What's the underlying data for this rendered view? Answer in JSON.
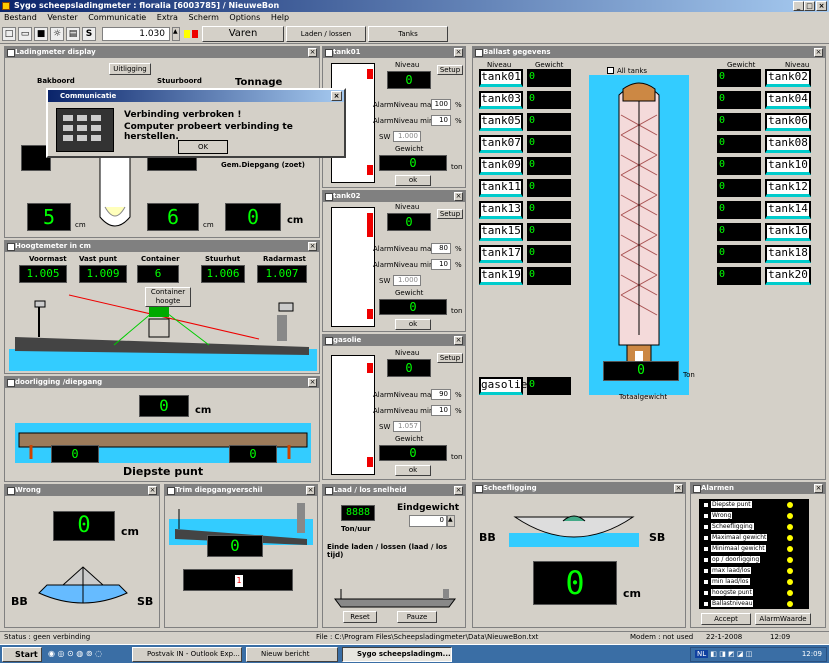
{
  "window": {
    "title": "Sygo scheepsladingmeter : floralia [6003785] / NieuweBon"
  },
  "menu": [
    "Bestand",
    "Venster",
    "Communicatie",
    "Extra",
    "Scherm",
    "Options",
    "Help"
  ],
  "toolbar": {
    "value": "1.030",
    "varen": "Varen",
    "laden": "Laden / lossen",
    "tanks": "Tanks"
  },
  "ladingmeter": {
    "title": "Ladingmeter display",
    "uitlogging": "Uitligging",
    "bakboord": "Bakboord",
    "stuurboord": "Stuurboord",
    "tonnage": "Tonnage",
    "gem_label": "Gem.Diepgang (zoet)",
    "v1": "5",
    "v2": "6",
    "v3": "0",
    "cm": "cm"
  },
  "dialog": {
    "title": "Communicatie",
    "line1": "Verbinding verbroken !",
    "line2": "Computer probeert verbinding te herstellen.",
    "ok": "OK"
  },
  "hoogtemeter": {
    "title": "Hoogtemeter in cm",
    "cols": [
      "Voormast",
      "Vast punt",
      "Container",
      "Stuurhut",
      "Radarmast"
    ],
    "vals": [
      "1.005",
      "1.009",
      "6",
      "1.006",
      "1.007"
    ],
    "container_hoogte": "Container hoogte"
  },
  "doorligging": {
    "title": "doorligging /diepgang",
    "v": "0",
    "cm": "cm",
    "left": "0",
    "right": "0",
    "diepste": "Diepste punt"
  },
  "tank01": {
    "title": "tank01",
    "niveau": "Niveau",
    "niveau_v": "0",
    "alarm_max": "AlarmNiveau max",
    "max_v": "100",
    "alarm_min": "AlarmNiveau min",
    "min_v": "10",
    "sw": "SW",
    "sw_v": "1.000",
    "gewicht": "Gewicht",
    "gew_v": "0",
    "ton": "ton",
    "ok": "ok",
    "setup": "Setup",
    "pct": "%"
  },
  "tank02": {
    "title": "tank02",
    "niveau": "Niveau",
    "niveau_v": "0",
    "alarm_max": "AlarmNiveau max",
    "max_v": "80",
    "alarm_min": "AlarmNiveau min",
    "min_v": "10",
    "sw": "SW",
    "sw_v": "1.000",
    "gewicht": "Gewicht",
    "gew_v": "0",
    "ton": "ton",
    "ok": "ok",
    "setup": "Setup",
    "pct": "%"
  },
  "gasolie": {
    "title": "gasolie",
    "niveau": "Niveau",
    "niveau_v": "0",
    "alarm_max": "AlarmNiveau max",
    "max_v": "90",
    "alarm_min": "AlarmNiveau min",
    "min_v": "10",
    "sw": "SW",
    "sw_v": "1.057",
    "gewicht": "Gewicht",
    "gew_v": "0",
    "ton": "ton",
    "ok": "ok",
    "setup": "Setup",
    "pct": "%"
  },
  "ballast": {
    "title": "Ballast gegevens",
    "niveau": "Niveau",
    "gewicht": "Gewicht",
    "all_tanks": "All tanks",
    "left": [
      [
        "tank01",
        "0"
      ],
      [
        "tank03",
        "0"
      ],
      [
        "tank05",
        "0"
      ],
      [
        "tank07",
        "0"
      ],
      [
        "tank09",
        "0"
      ],
      [
        "tank11",
        "0"
      ],
      [
        "tank13",
        "0"
      ],
      [
        "tank15",
        "0"
      ],
      [
        "tank17",
        "0"
      ],
      [
        "tank19",
        "0"
      ]
    ],
    "right": [
      [
        "tank02",
        "0"
      ],
      [
        "tank04",
        "0"
      ],
      [
        "tank06",
        "0"
      ],
      [
        "tank08",
        "0"
      ],
      [
        "tank10",
        "0"
      ],
      [
        "tank12",
        "0"
      ],
      [
        "tank14",
        "0"
      ],
      [
        "tank16",
        "0"
      ],
      [
        "tank18",
        "0"
      ],
      [
        "tank20",
        "0"
      ]
    ],
    "gasolie": "gasolie",
    "gasolie_v": "0",
    "total_v": "0",
    "ton": "Ton",
    "totaalgewicht": "Totaalgewicht"
  },
  "wrong": {
    "title": "Wrong",
    "v": "0",
    "cm": "cm",
    "bb": "BB",
    "sb": "SB"
  },
  "trim": {
    "title": "Trim diepgangverschil",
    "v": "0",
    "small": "1"
  },
  "laad": {
    "title": "Laad / los snelheid",
    "lcd": "8888",
    "tonuur": "Ton/uur",
    "eind": "Eindgewicht",
    "eind_v": "0",
    "einde": "Einde laden / lossen (laad / los tijd)",
    "reset": "Reset",
    "pauze": "Pauze"
  },
  "scheef": {
    "title": "Scheefligging",
    "v": "0",
    "cm": "cm",
    "bb": "BB",
    "sb": "SB"
  },
  "alarmen": {
    "title": "Alarmen",
    "items": [
      "Diepste punt",
      "Wrong",
      "Scheefligging",
      "Maximaal gewicht",
      "Minimaal gewicht",
      "op / doorligging",
      "max laad/los",
      "min laad/los",
      "hoogste punt",
      "Ballastniveau"
    ],
    "accept": "Accept",
    "alarmwaarde": "AlarmWaarde"
  },
  "status": {
    "left": "Status : geen verbinding",
    "file": "File : C:\\Program Files\\Scheepsladingmeter\\Data\\NieuweBon.txt",
    "modem": "Modem : not used",
    "date": "22-1-2008",
    "time": "12:09"
  },
  "taskbar": {
    "start": "Start",
    "tasks": [
      "Postvak IN - Outlook Exp...",
      "Nieuw bericht",
      "Sygo scheepsladingm..."
    ],
    "clock": "12:09",
    "lang": "NL"
  }
}
